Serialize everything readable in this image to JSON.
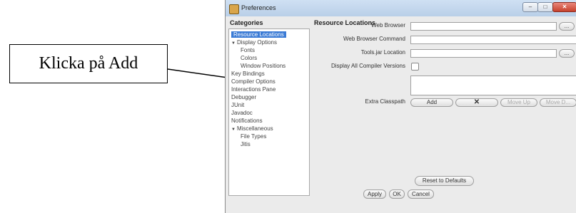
{
  "callout": {
    "text": "Klicka på Add"
  },
  "window": {
    "title": "Preferences",
    "controls": {
      "minimize": "–",
      "maximize": "□",
      "close": "✕"
    }
  },
  "categories": {
    "header": "Categories",
    "items": [
      {
        "label": "Resource Locations",
        "selected": true
      },
      {
        "label": "Display Options",
        "expanded": true
      },
      {
        "label": "Fonts"
      },
      {
        "label": "Colors"
      },
      {
        "label": "Window Positions"
      },
      {
        "label": "Key Bindings"
      },
      {
        "label": "Compiler Options"
      },
      {
        "label": "Interactions Pane"
      },
      {
        "label": "Debugger"
      },
      {
        "label": "JUnit"
      },
      {
        "label": "Javadoc"
      },
      {
        "label": "Notifications"
      },
      {
        "label": "Miscellaneous",
        "expanded": true
      },
      {
        "label": "File Types"
      },
      {
        "label": "Jitis"
      }
    ]
  },
  "panel": {
    "header": "Resource Locations",
    "web_browser_label": "Web Browser",
    "web_browser_command_label": "Web Browser Command",
    "tools_jar_label": "Tools.jar Location",
    "display_compilers_label": "Display All Compiler Versions",
    "extra_classpath_label": "Extra Classpath",
    "browse_label": "...",
    "add_label": "Add",
    "remove_label": "✕",
    "move_up_label": "Move Up",
    "move_down_label": "Move D...",
    "reset_label": "Reset to Defaults"
  },
  "footer": {
    "apply": "Apply",
    "ok": "OK",
    "cancel": "Cancel"
  }
}
